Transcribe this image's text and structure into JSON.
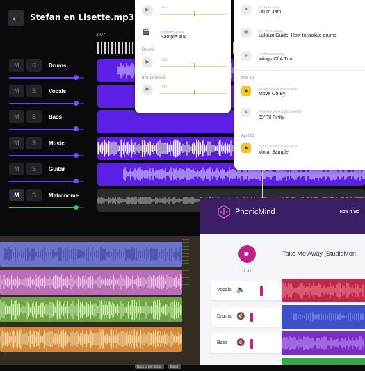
{
  "mixer": {
    "title": "Stefan en Lisette.mp3",
    "timecode": "2:07",
    "tracks": [
      {
        "name": "Drums",
        "m": "M",
        "s": "S",
        "level": 0.9
      },
      {
        "name": "Vocals",
        "m": "M",
        "s": "S",
        "level": 0.9
      },
      {
        "name": "Bass",
        "m": "M",
        "s": "S",
        "level": 0.9
      },
      {
        "name": "Music",
        "m": "M",
        "s": "S",
        "level": 0.9
      },
      {
        "name": "Guitar",
        "m": "M",
        "s": "S",
        "level": 0.9
      },
      {
        "name": "Metronome",
        "m": "M",
        "s": "S",
        "level": 0.9
      }
    ],
    "accent": "#6b3cff"
  },
  "preview": {
    "rows": [
      {
        "time": "0:42"
      },
      {
        "meta": "Preview • Drums",
        "title": "Sample 404"
      },
      {
        "section": "Drums",
        "time": "0:11"
      },
      {
        "section": "Instrumental",
        "time": "0:11"
      }
    ]
  },
  "list": {
    "items": [
      {
        "meta": "7% • Unlocking...",
        "title": "Drum Jam"
      },
      {
        "meta": "1% • Processing...",
        "title": "Lalal.ai Guide: How to isolate drums"
      },
      {
        "meta": "7% • Downloading...",
        "title": "Wings Of A Turn"
      },
      {
        "date": "May 13"
      },
      {
        "meta": "$375 • Vocal & Instrumental",
        "title": "Move On By"
      },
      {
        "meta": "Preview • Vocal & Instrumental",
        "title": "39' Til Finity"
      },
      {
        "date": "April 23"
      },
      {
        "meta": "£0.56 • Vocal & Instrumental",
        "title": "Vocal Sample"
      }
    ]
  },
  "multitrack": {
    "buttons": [
      "Back to my tracks",
      "Export"
    ]
  },
  "phonic": {
    "brand": "PhonicMind",
    "nav": "HOW IT WO",
    "song": "Take Me Away [StudioMon",
    "time": "1:31",
    "stems": [
      "Vocals",
      "Drums",
      "Bass"
    ],
    "colors": {
      "header": "#3a1f66",
      "accent": "#c11f8c"
    }
  }
}
